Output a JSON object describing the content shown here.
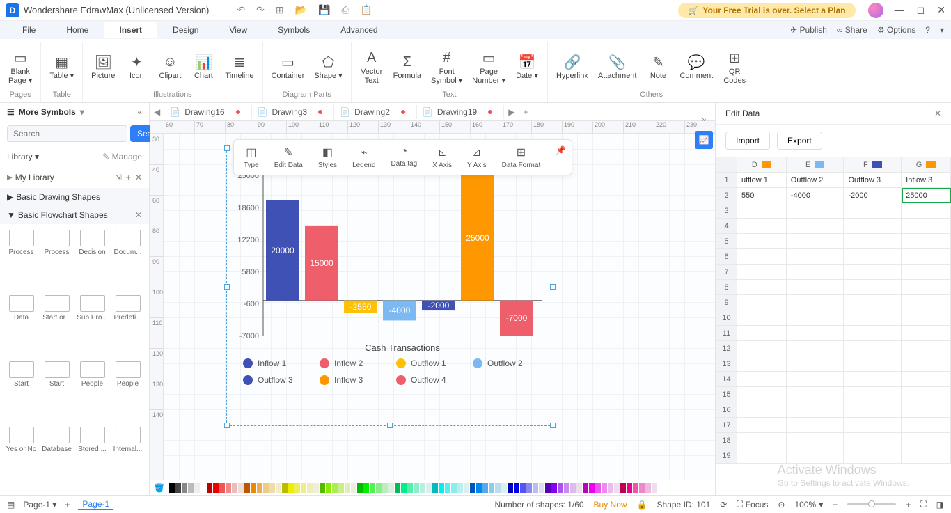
{
  "app": {
    "title": "Wondershare EdrawMax (Unlicensed Version)",
    "trial": "Your Free Trial is over. Select a Plan"
  },
  "menubar": {
    "items": [
      "File",
      "Home",
      "Insert",
      "Design",
      "View",
      "Symbols",
      "Advanced"
    ],
    "active": 2,
    "right": {
      "publish": "Publish",
      "share": "Share",
      "options": "Options"
    }
  },
  "ribbon": {
    "groups": [
      {
        "label": "Pages",
        "items": [
          {
            "icon": "▭",
            "label": "Blank\nPage ▾"
          }
        ]
      },
      {
        "label": "Table",
        "items": [
          {
            "icon": "▦",
            "label": "Table ▾"
          }
        ]
      },
      {
        "label": "Illustrations",
        "items": [
          {
            "icon": "🖼",
            "label": "Picture"
          },
          {
            "icon": "✦",
            "label": "Icon"
          },
          {
            "icon": "☺",
            "label": "Clipart"
          },
          {
            "icon": "📊",
            "label": "Chart"
          },
          {
            "icon": "≣",
            "label": "Timeline"
          }
        ]
      },
      {
        "label": "Diagram Parts",
        "items": [
          {
            "icon": "▭",
            "label": "Container"
          },
          {
            "icon": "⬠",
            "label": "Shape ▾"
          }
        ]
      },
      {
        "label": "Text",
        "items": [
          {
            "icon": "A",
            "label": "Vector\nText"
          },
          {
            "icon": "Σ",
            "label": "Formula"
          },
          {
            "icon": "#",
            "label": "Font\nSymbol ▾"
          },
          {
            "icon": "▭",
            "label": "Page\nNumber ▾"
          },
          {
            "icon": "📅",
            "label": "Date ▾"
          }
        ]
      },
      {
        "label": "Others",
        "items": [
          {
            "icon": "🔗",
            "label": "Hyperlink"
          },
          {
            "icon": "📎",
            "label": "Attachment"
          },
          {
            "icon": "✎",
            "label": "Note"
          },
          {
            "icon": "💬",
            "label": "Comment"
          },
          {
            "icon": "⊞",
            "label": "QR\nCodes"
          }
        ]
      }
    ]
  },
  "leftpanel": {
    "title": "More Symbols",
    "search_placeholder": "Search",
    "search_btn": "Search",
    "library": "Library ▾",
    "manage": "Manage",
    "mylib": "My Library",
    "sections": [
      "Basic Drawing Shapes",
      "Basic Flowchart Shapes"
    ],
    "shapes": [
      "Process",
      "Process",
      "Decision",
      "Docum...",
      "Data",
      "Start or...",
      "Sub Pro...",
      "Predefi...",
      "Start",
      "Start",
      "People",
      "People",
      "Yes or No",
      "Database",
      "Stored ...",
      "Internal..."
    ]
  },
  "tabs": [
    {
      "name": "Drawing16",
      "dirty": true
    },
    {
      "name": "Drawing3",
      "dirty": true
    },
    {
      "name": "Drawing2",
      "dirty": true
    },
    {
      "name": "Drawing19",
      "dirty": true
    }
  ],
  "ruler_h": [
    "60",
    "70",
    "80",
    "90",
    "100",
    "110",
    "120",
    "130",
    "140",
    "150",
    "160",
    "170",
    "180",
    "190",
    "200",
    "210",
    "220",
    "230"
  ],
  "ruler_v": [
    "30",
    "40",
    "60",
    "80",
    "90",
    "100",
    "110",
    "120",
    "130",
    "140"
  ],
  "floating_toolbar": [
    "Type",
    "Edit Data",
    "Styles",
    "Legend",
    "Data tag",
    "X Axis",
    "Y Axis",
    "Data Format"
  ],
  "floating_icons": [
    "◫",
    "✎",
    "◧",
    "⌁",
    "◔",
    "⊾",
    "⊿",
    "⊞"
  ],
  "chart_data": {
    "type": "bar",
    "title": "Cash Transactions",
    "y_ticks": [
      25000,
      18600,
      12200,
      5800,
      -600,
      -7000
    ],
    "y_range": [
      -7000,
      25000
    ],
    "series": [
      {
        "name": "Inflow 1",
        "color": "#3f51b5",
        "value": 20000
      },
      {
        "name": "Inflow 2",
        "color": "#ef5f6b",
        "value": 15000
      },
      {
        "name": "Outflow 1",
        "color": "#ffc107",
        "value": -2550
      },
      {
        "name": "Outflow 2",
        "color": "#7cb9f2",
        "value": -4000
      },
      {
        "name": "Outflow 3",
        "color": "#3f51b5",
        "value": -2000
      },
      {
        "name": "Inflow 3",
        "color": "#ff9800",
        "value": 25000
      },
      {
        "name": "Outflow 4",
        "color": "#ef5f6b",
        "value": -7000
      }
    ],
    "legend": [
      {
        "name": "Inflow 1",
        "color": "#3f51b5"
      },
      {
        "name": "Inflow 2",
        "color": "#ef5f6b"
      },
      {
        "name": "Outflow 1",
        "color": "#ffc107"
      },
      {
        "name": "Outflow 2",
        "color": "#7cb9f2"
      },
      {
        "name": "Outflow 3",
        "color": "#3f51b5"
      },
      {
        "name": "Inflow 3",
        "color": "#ff9800"
      },
      {
        "name": "Outflow 4",
        "color": "#ef5f6b"
      }
    ]
  },
  "rightpanel": {
    "title": "Edit Data",
    "import": "Import",
    "export": "Export",
    "cols": [
      {
        "h": "D",
        "sw": "#ff9800"
      },
      {
        "h": "E",
        "sw": "#7cb9f2"
      },
      {
        "h": "F",
        "sw": "#3f51b5"
      },
      {
        "h": "G",
        "sw": "#ff9800"
      }
    ],
    "header_row": [
      "utflow 1",
      "Outflow 2",
      "Outflow 3",
      "Inflow 3"
    ],
    "data_row": [
      "550",
      "-4000",
      "-2000",
      "25000"
    ],
    "selected_cell": "25000",
    "row_count": 19
  },
  "statusbar": {
    "page_select": "Page-1",
    "page_tab": "Page-1",
    "shapes": "Number of shapes: 1/60",
    "buy": "Buy Now",
    "shape_id": "Shape ID: 101",
    "focus": "Focus",
    "zoom": "100%"
  },
  "watermark": {
    "line1": "Activate Windows",
    "line2": "Go to Settings to activate Windows."
  },
  "colors": [
    "#000",
    "#444",
    "#888",
    "#bbb",
    "#eee",
    "#fff",
    "#b00",
    "#e00",
    "#e55",
    "#e88",
    "#ebb",
    "#edd",
    "#b50",
    "#e80",
    "#ea5",
    "#ec8",
    "#eda",
    "#eec",
    "#bb0",
    "#ee0",
    "#ee5",
    "#ee8",
    "#eeb",
    "#eed",
    "#5b0",
    "#8e0",
    "#ae5",
    "#ce8",
    "#deb",
    "#eed",
    "#0b0",
    "#0e0",
    "#5e5",
    "#8e8",
    "#beb",
    "#ded",
    "#0b5",
    "#0e8",
    "#5ea",
    "#8ec",
    "#bed",
    "#dee",
    "#0bb",
    "#0ee",
    "#5ee",
    "#8ee",
    "#bee",
    "#dee",
    "#05b",
    "#08e",
    "#5ae",
    "#8ce",
    "#bde",
    "#dee",
    "#00b",
    "#00e",
    "#55e",
    "#88e",
    "#bbe",
    "#dde",
    "#50b",
    "#80e",
    "#a5e",
    "#c8e",
    "#dbe",
    "#ede",
    "#b0b",
    "#e0e",
    "#e5e",
    "#e8e",
    "#ebe",
    "#ede",
    "#b05",
    "#e08",
    "#e5a",
    "#e8c",
    "#ebd",
    "#ede"
  ]
}
